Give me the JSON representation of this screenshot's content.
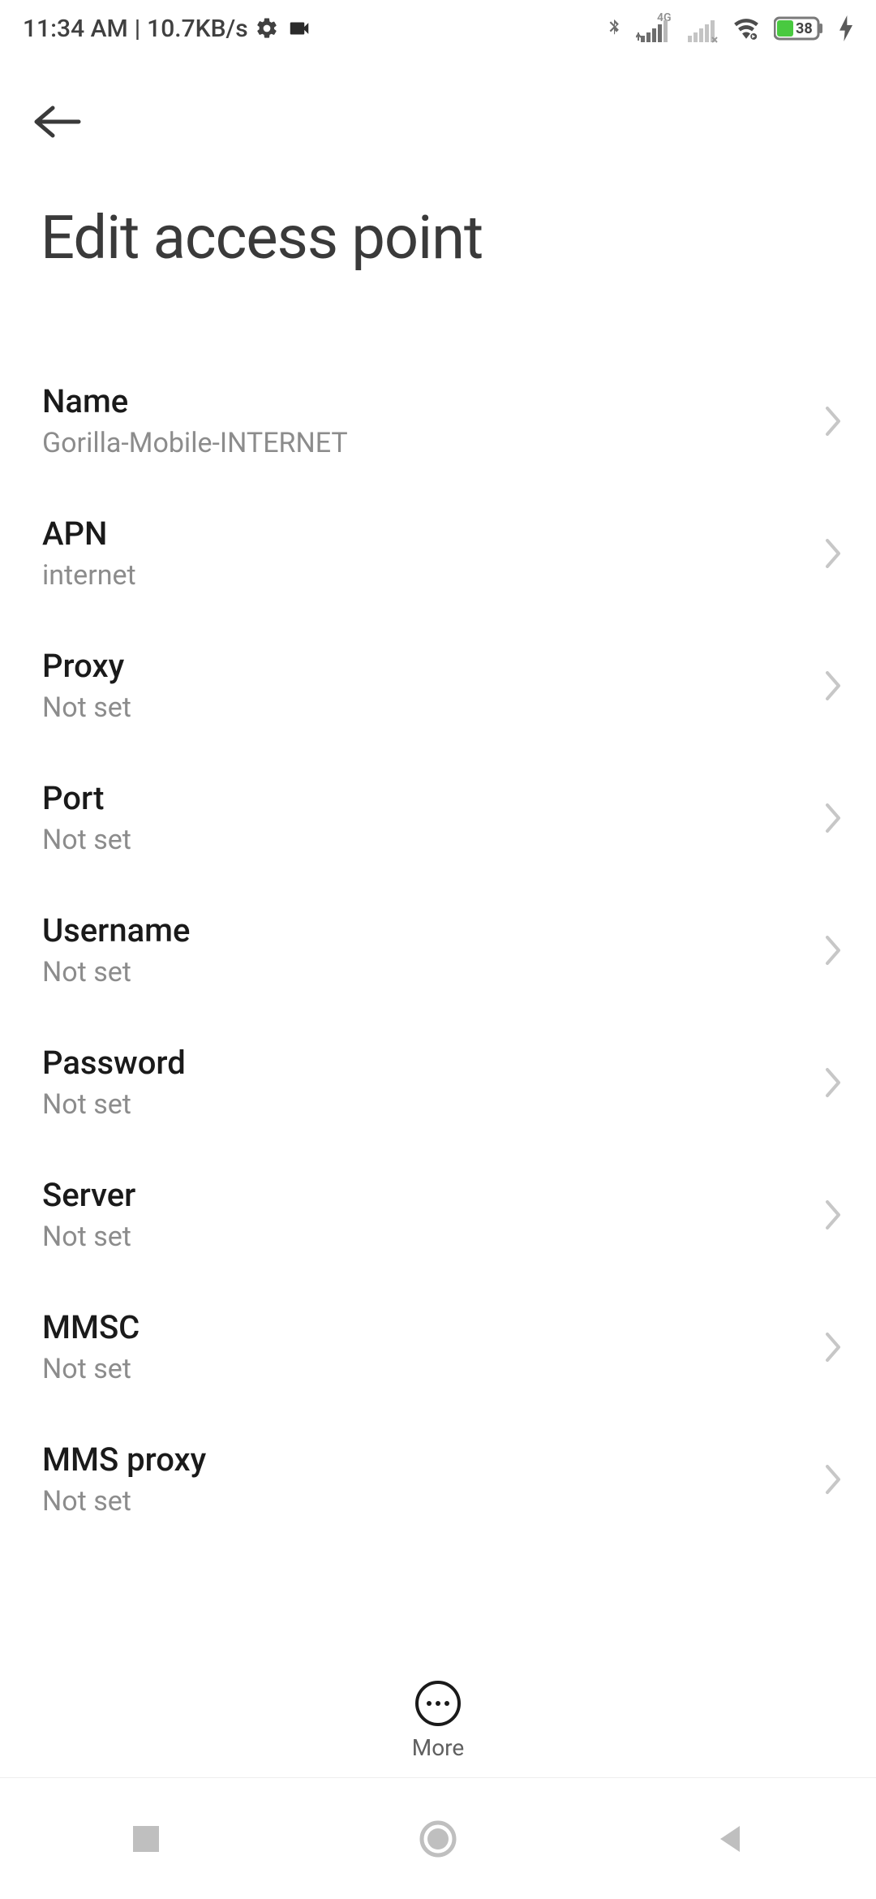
{
  "status": {
    "time": "11:34 AM",
    "separator": "|",
    "speed": "10.7KB/s",
    "battery_level": "38",
    "network_label": "4G"
  },
  "header": {
    "title": "Edit access point"
  },
  "settings": [
    {
      "label": "Name",
      "value": "Gorilla-Mobile-INTERNET"
    },
    {
      "label": "APN",
      "value": "internet"
    },
    {
      "label": "Proxy",
      "value": "Not set"
    },
    {
      "label": "Port",
      "value": "Not set"
    },
    {
      "label": "Username",
      "value": "Not set"
    },
    {
      "label": "Password",
      "value": "Not set"
    },
    {
      "label": "Server",
      "value": "Not set"
    },
    {
      "label": "MMSC",
      "value": "Not set"
    },
    {
      "label": "MMS proxy",
      "value": "Not set"
    }
  ],
  "bottom": {
    "more_label": "More"
  }
}
